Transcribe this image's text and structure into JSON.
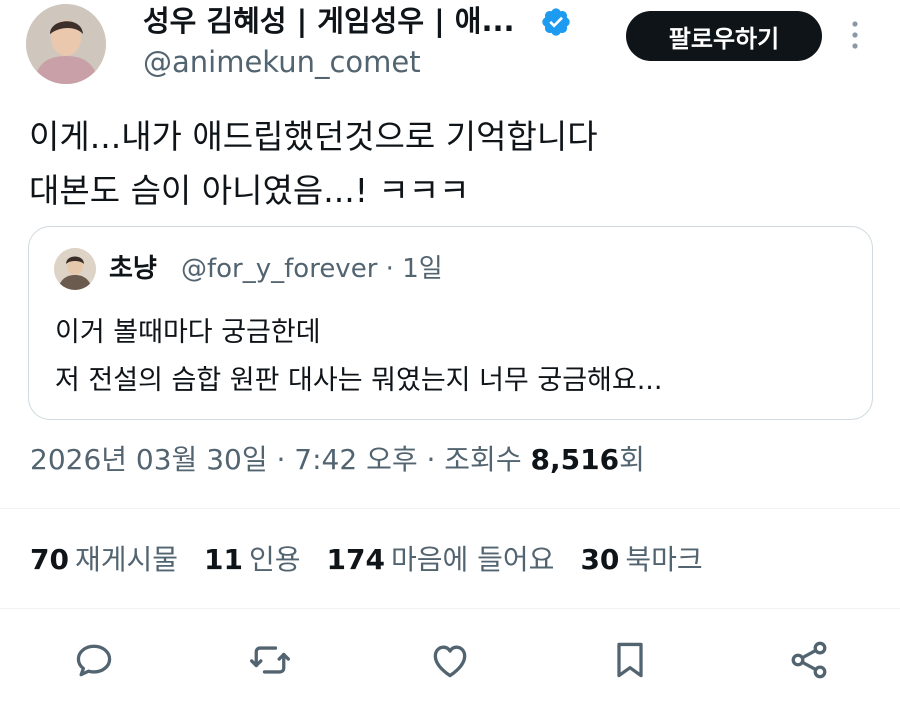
{
  "author": {
    "display_name": "성우 김혜성 | 게임성우 | 애...",
    "handle": "@animekun_comet",
    "verified": true
  },
  "follow_button": {
    "label": "팔로우하기"
  },
  "tweet": {
    "text": "이게...내가 애드립했던것으로 기억합니다\n대본도 슴이 아니였음...! ㅋㅋㅋ"
  },
  "quoted_tweet": {
    "name": "초냥",
    "handle": "@for_y_forever",
    "time": "1일",
    "text": "이거 볼때마다 궁금한데\n저 전설의 슴합 원판 대사는 뭐였는지 너무 궁금해요..."
  },
  "meta": {
    "timestamp": "2026년 03월 30일 · 7:42 오후 · 조회수 ",
    "views": "8,516",
    "views_suffix": "회"
  },
  "stats": {
    "reposts": {
      "count": "70",
      "label": "재게시물"
    },
    "quotes": {
      "count": "11",
      "label": "인용"
    },
    "likes": {
      "count": "174",
      "label": "마음에 들어요"
    },
    "bookmarks": {
      "count": "30",
      "label": "북마크"
    }
  },
  "icons": {
    "reply": "reply-icon",
    "repost": "repost-icon",
    "like": "like-icon",
    "bookmark": "bookmark-icon",
    "share": "share-icon"
  },
  "colors": {
    "verified_blue": "#1d9bf0",
    "text_secondary": "#536471",
    "button_bg": "#0f1419"
  }
}
